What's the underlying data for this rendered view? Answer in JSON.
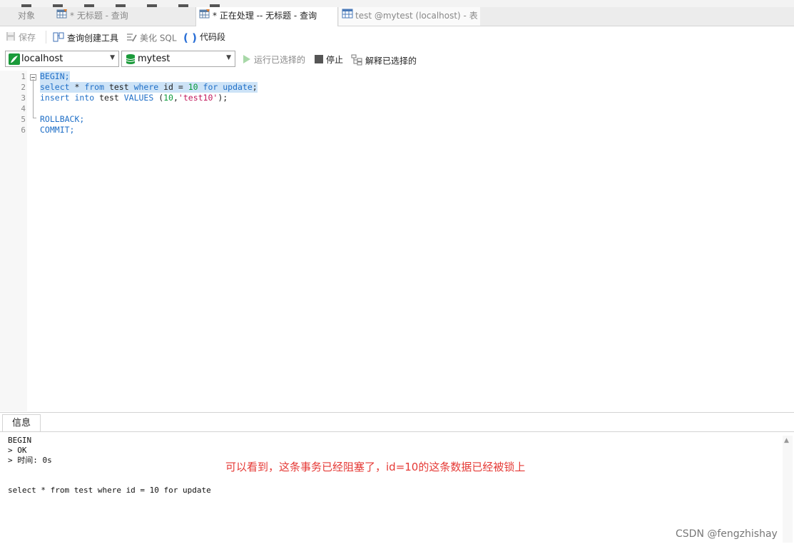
{
  "tabs": [
    {
      "label": "对象",
      "icon": ""
    },
    {
      "label": "* 无标题 - 查询",
      "icon": "query-table-icon"
    },
    {
      "label": "* 正在处理 -- 无标题 - 查询",
      "icon": "query-table-icon"
    },
    {
      "label": "test @mytest (localhost) - 表",
      "icon": "table-icon"
    }
  ],
  "toolbar": {
    "save": "保存",
    "query_builder": "查询创建工具",
    "beautify_sql": "美化 SQL",
    "code_snippet": "代码段"
  },
  "connection": {
    "server": "localhost",
    "database": "mytest",
    "run_selected": "运行已选择的",
    "stop": "停止",
    "explain_selected": "解释已选择的"
  },
  "editor": {
    "line_numbers": [
      "1",
      "2",
      "3",
      "4",
      "5",
      "6"
    ],
    "lines": [
      "BEGIN;",
      "select * from test where id = 10 for update;",
      "insert into test VALUES (10,'test10');",
      "",
      "ROLLBACK;",
      "COMMIT;"
    ]
  },
  "result": {
    "tab_label": "信息",
    "output_lines": [
      "BEGIN",
      "> OK",
      "> 时间: 0s",
      "",
      "",
      "select * from test where id = 10 for update"
    ],
    "annotation": "可以看到，这条事务已经阻塞了，id=10的这条数据已经被锁上"
  },
  "watermark": "CSDN @fengzhishay",
  "colors": {
    "keyword": "#1f6fc7",
    "number": "#0a9a3a",
    "string": "#c2185b",
    "selection": "#cde3f7",
    "annotation": "#e53935"
  }
}
